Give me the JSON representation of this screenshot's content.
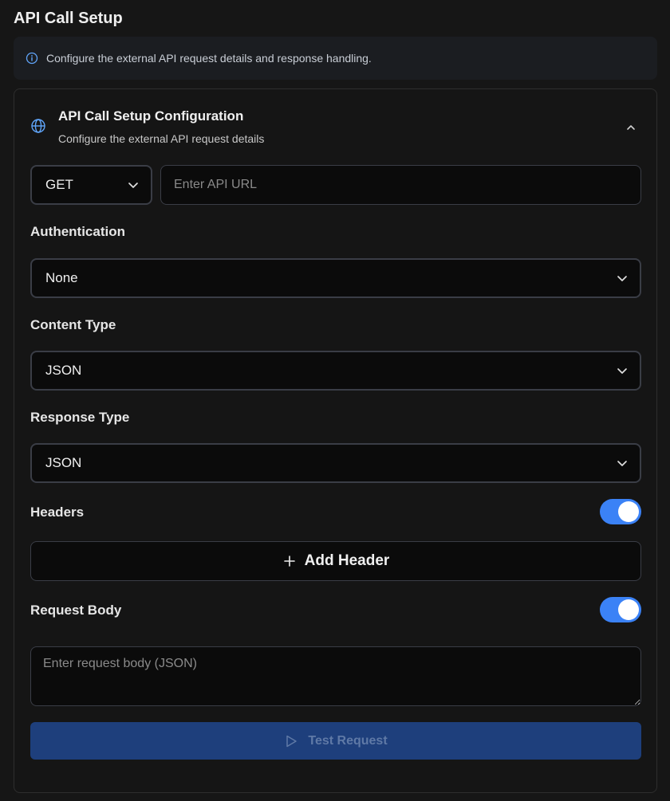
{
  "page": {
    "title": "API Call Setup",
    "info_text": "Configure the external API request details and response handling."
  },
  "card": {
    "title": "API Call Setup Configuration",
    "subtitle": "Configure the external API request details",
    "icon": "globe-icon",
    "collapse_icon": "chevron-up-icon"
  },
  "request": {
    "method": "GET",
    "url_value": "",
    "url_placeholder": "Enter API URL"
  },
  "authentication": {
    "label": "Authentication",
    "value": "None"
  },
  "content_type": {
    "label": "Content Type",
    "value": "JSON"
  },
  "response_type": {
    "label": "Response Type",
    "value": "JSON"
  },
  "headers": {
    "label": "Headers",
    "enabled": true,
    "add_label": "Add Header"
  },
  "request_body": {
    "label": "Request Body",
    "enabled": true,
    "value": "",
    "placeholder": "Enter request body (JSON)"
  },
  "test_button": {
    "label": "Test Request",
    "enabled": false
  },
  "colors": {
    "accent": "#3b82f6",
    "info_icon": "#60a5fa",
    "background": "#161616",
    "disabled_button": "#1e3f7c"
  }
}
